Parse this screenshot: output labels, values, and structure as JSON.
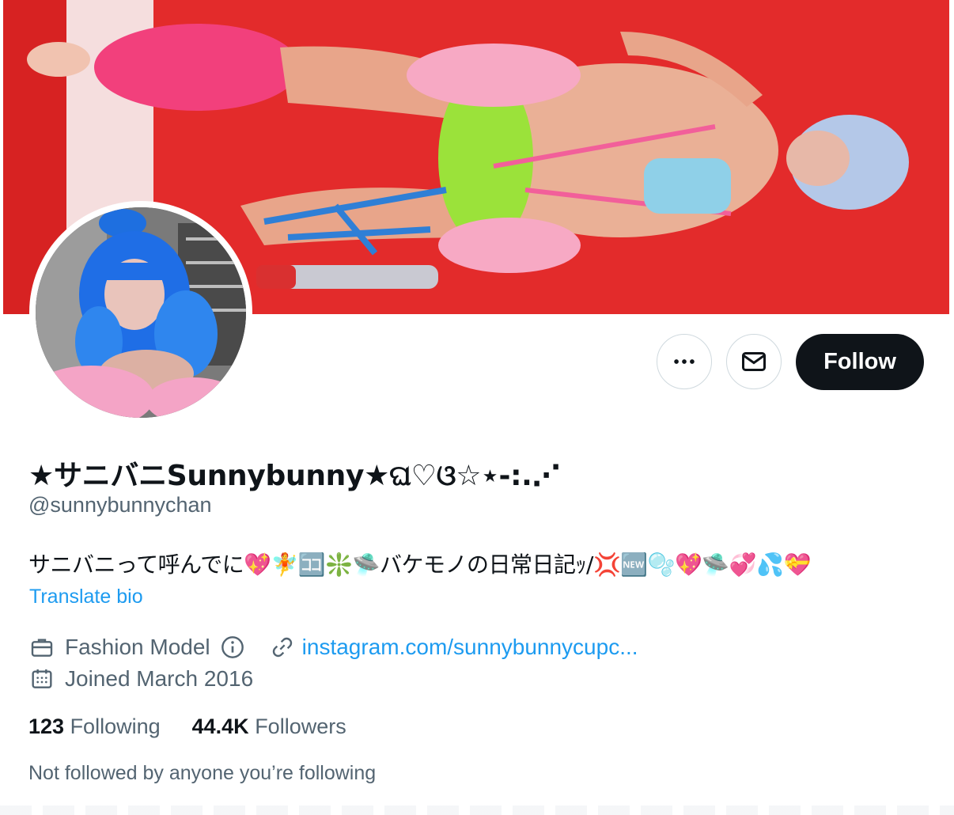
{
  "profile": {
    "display_name": "★サニバニSunnybunny★ଘ♡ଓ☆⋆-:.⋰",
    "handle": "@sunnybunnychan",
    "bio": "サニバニって呼んでに💖🧚🈁❇️🛸バケモノの日常日記ｯ/💢🆕🫧💖🛸💞💦💝",
    "translate_label": "Translate bio",
    "category": "Fashion Model",
    "link": "instagram.com/sunnybunnycupc...",
    "joined": "Joined March 2016"
  },
  "actions": {
    "more_icon": "more-horizontal-icon",
    "message_icon": "envelope-icon",
    "follow_label": "Follow"
  },
  "stats": {
    "following_count": "123",
    "following_label": "Following",
    "followers_count": "44.4K",
    "followers_label": "Followers"
  },
  "followed_by_text": "Not followed by anyone you’re following",
  "colors": {
    "accent": "#1d9bf0",
    "text_primary": "#0f1419",
    "text_secondary": "#536471",
    "banner_bg": "#e53030",
    "follow_button_bg": "#0f1419"
  }
}
